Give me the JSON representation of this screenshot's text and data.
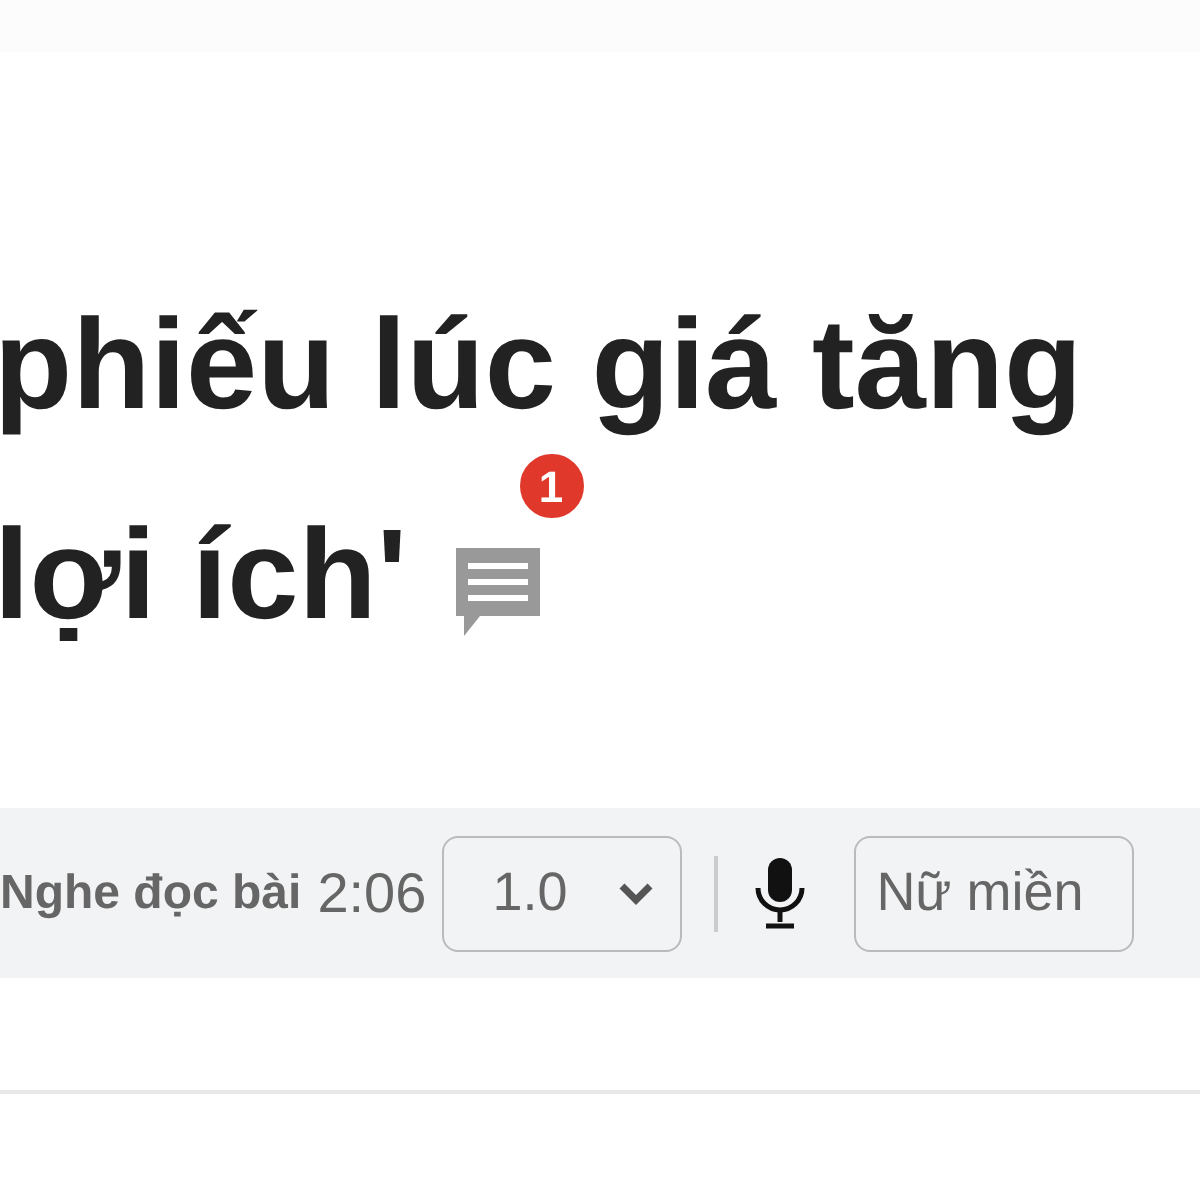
{
  "title_lines": [
    "phiếu lúc giá tăng",
    "lợi ích'"
  ],
  "comments": {
    "count": "1"
  },
  "audio_player": {
    "label": "Nghe đọc bài",
    "duration": "2:06",
    "speed": "1.0",
    "voice": "Nữ miền"
  }
}
